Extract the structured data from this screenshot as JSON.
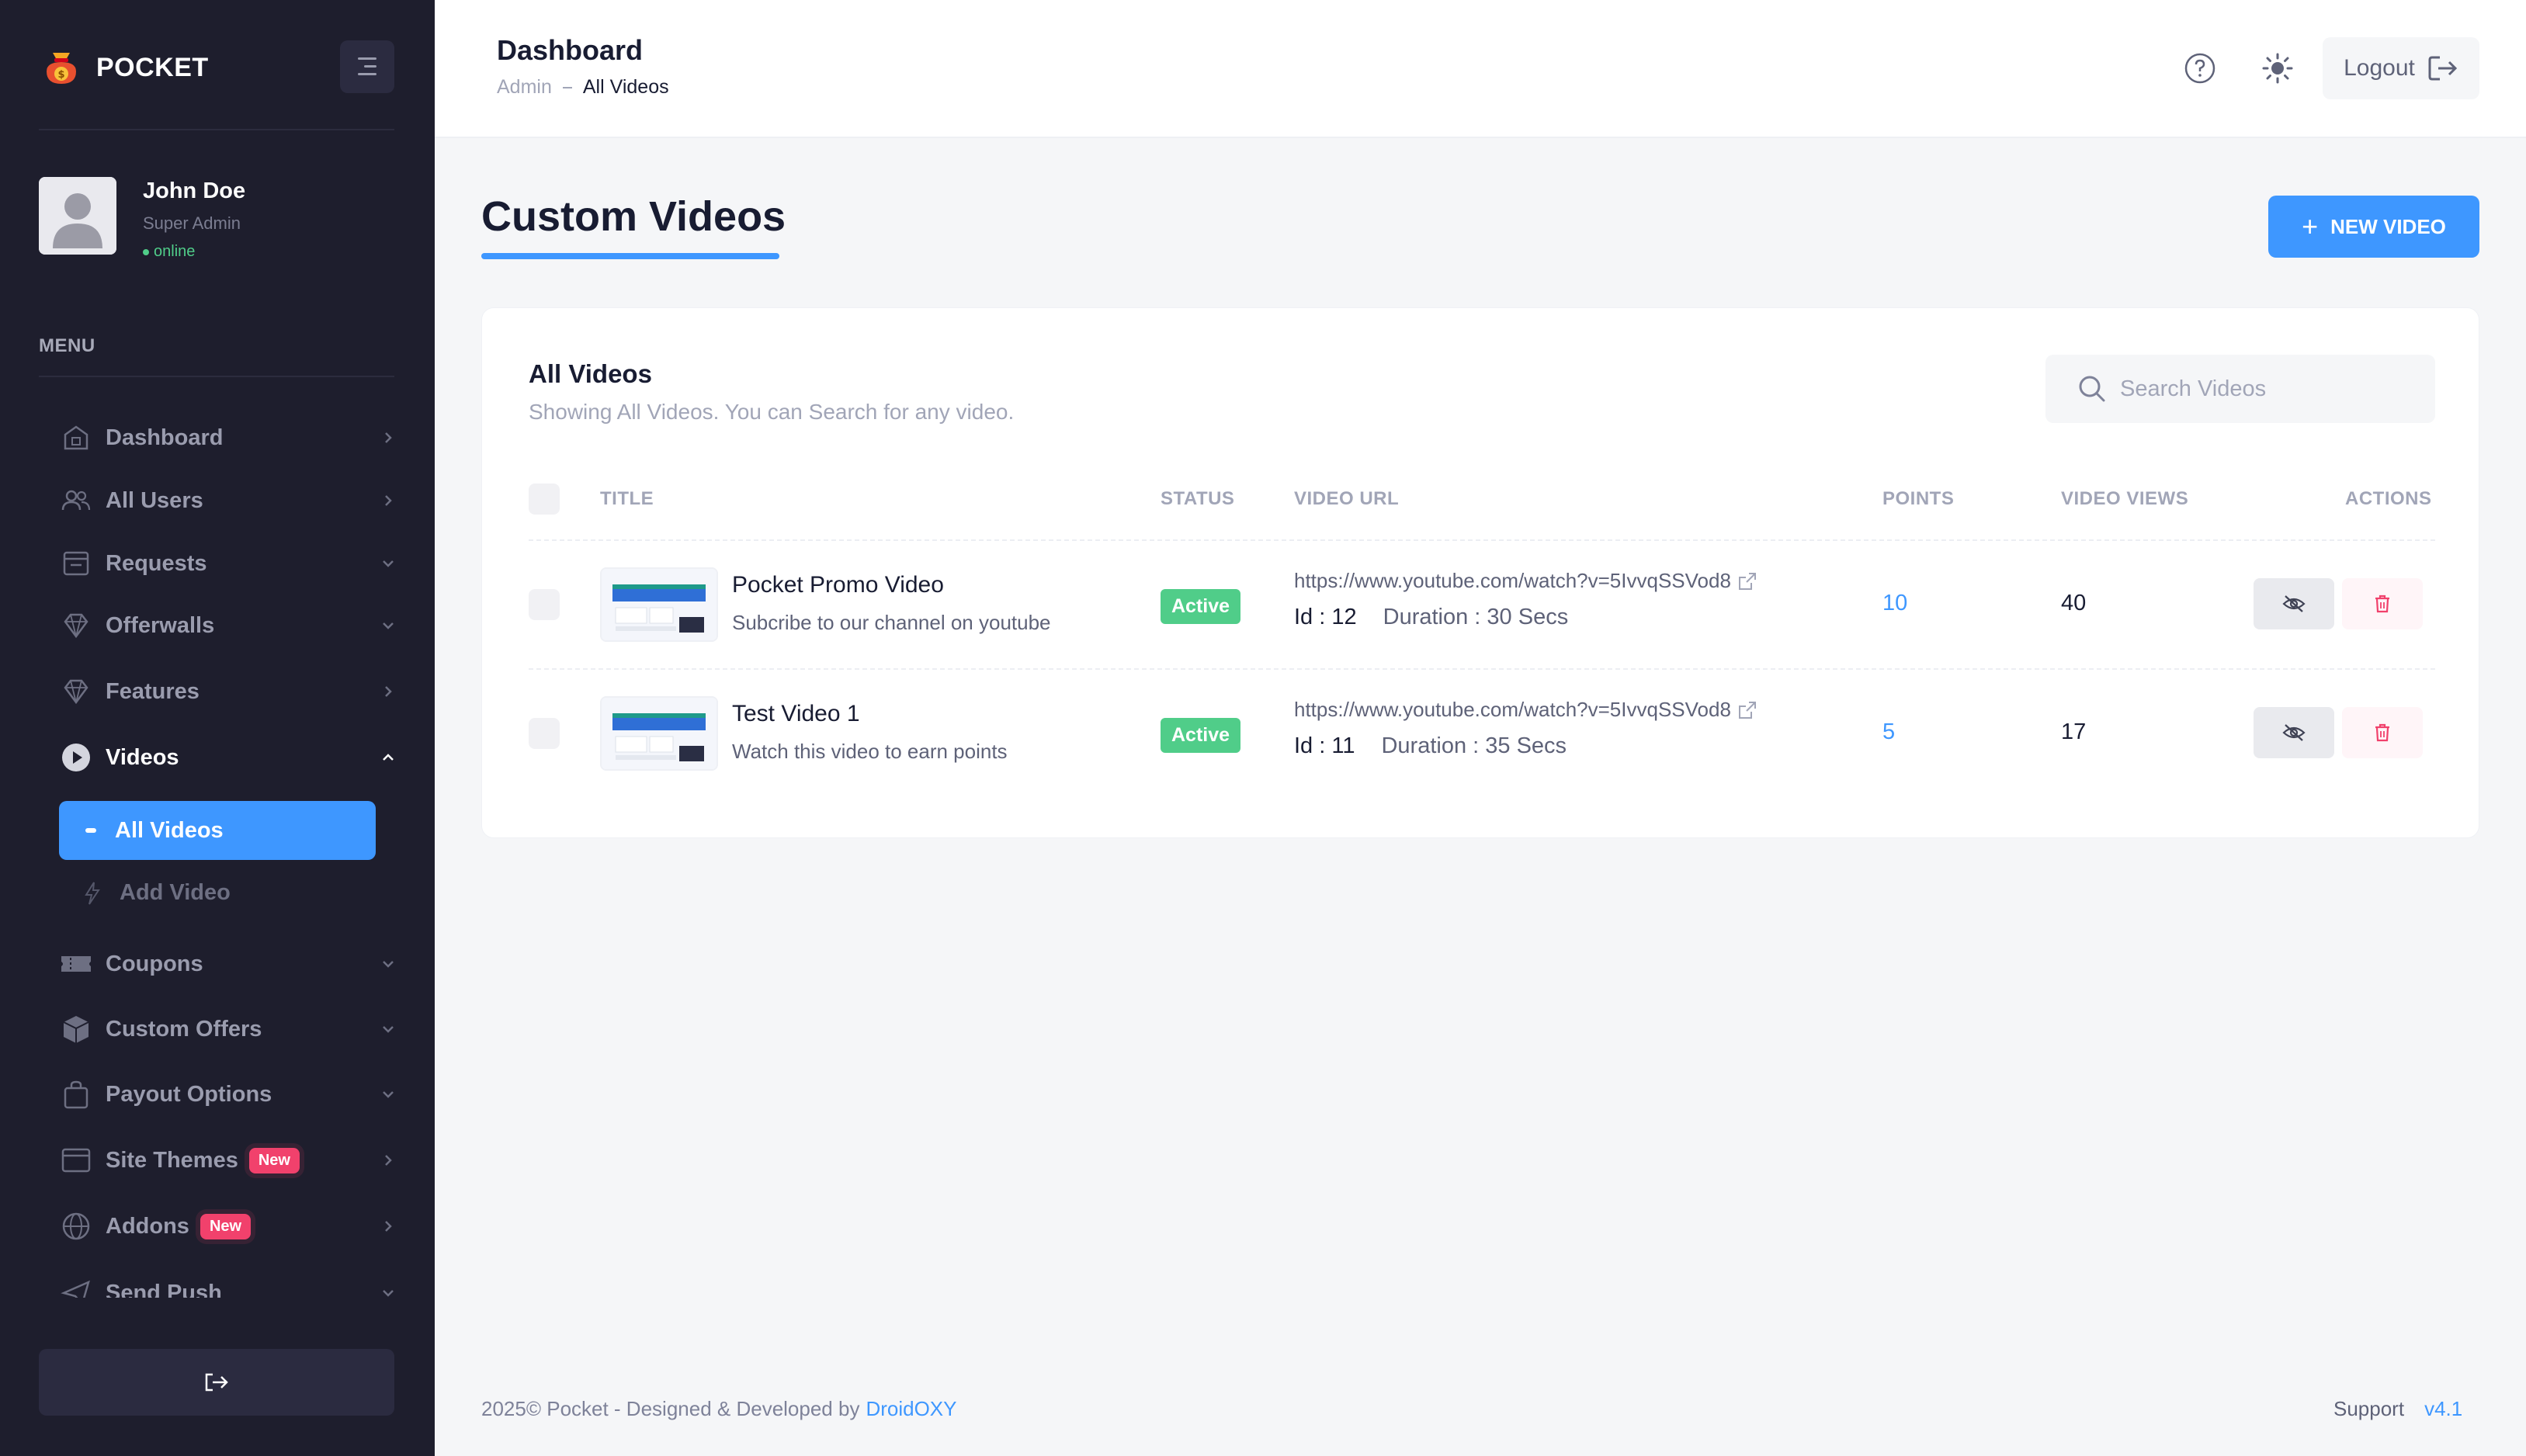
{
  "app": {
    "brand": "POCKET"
  },
  "sidebar": {
    "user": {
      "name": "John Doe",
      "role": "Super Admin",
      "status": "online"
    },
    "menu_title": "MENU",
    "items": [
      {
        "label": "Dashboard",
        "icon": "dashboard-icon",
        "chevron": "right"
      },
      {
        "label": "All Users",
        "icon": "users-icon",
        "chevron": "right"
      },
      {
        "label": "Requests",
        "icon": "requests-icon",
        "chevron": "down"
      },
      {
        "label": "Offerwalls",
        "icon": "diamond-icon",
        "chevron": "down"
      },
      {
        "label": "Features",
        "icon": "diamond-icon",
        "chevron": "right"
      },
      {
        "label": "Videos",
        "icon": "play-icon",
        "chevron": "up",
        "open": true
      },
      {
        "label": "Coupons",
        "icon": "ticket-icon",
        "chevron": "down"
      },
      {
        "label": "Custom Offers",
        "icon": "box-icon",
        "chevron": "down"
      },
      {
        "label": "Payout Options",
        "icon": "bag-icon",
        "chevron": "down"
      },
      {
        "label": "Site Themes",
        "icon": "browser-icon",
        "chevron": "right",
        "badge": "New"
      },
      {
        "label": "Addons",
        "icon": "globe-icon",
        "chevron": "right",
        "badge": "New"
      },
      {
        "label": "Send Push",
        "icon": "send-icon",
        "chevron": "down"
      }
    ],
    "sub_items": [
      {
        "label": "All Videos",
        "active": true
      },
      {
        "label": "Add Video",
        "active": false
      }
    ]
  },
  "header": {
    "title": "Dashboard",
    "breadcrumb": [
      "Admin",
      "All Videos"
    ],
    "logout_label": "Logout"
  },
  "main": {
    "page_title": "Custom Videos",
    "new_button": "NEW VIDEO",
    "card": {
      "title": "All Videos",
      "subtitle": "Showing All Videos. You can Search for any video.",
      "search_placeholder": "Search Videos"
    },
    "columns": [
      "TITLE",
      "STATUS",
      "VIDEO URL",
      "POINTS",
      "VIDEO VIEWS",
      "ACTIONS"
    ],
    "rows": [
      {
        "title": "Pocket Promo Video",
        "description": "Subcribe to our channel on youtube",
        "status": "Active",
        "url": "https://www.youtube.com/watch?v=5IvvqSSVod8",
        "id": "Id : 12",
        "duration": "Duration : 30 Secs",
        "points": "10",
        "views": "40"
      },
      {
        "title": "Test Video 1",
        "description": "Watch this video to earn points",
        "status": "Active",
        "url": "https://www.youtube.com/watch?v=5IvvqSSVod8",
        "id": "Id : 11",
        "duration": "Duration : 35 Secs",
        "points": "5",
        "views": "17"
      }
    ]
  },
  "footer": {
    "copyright": "2025©  Pocket - Designed & Developed by",
    "developer": "DroidOXY",
    "support": "Support",
    "version": "v4.1"
  },
  "colors": {
    "sidebar_bg": "#1e1e2d",
    "primary": "#3e97ff",
    "success": "#50cd89",
    "danger": "#f1416c"
  }
}
